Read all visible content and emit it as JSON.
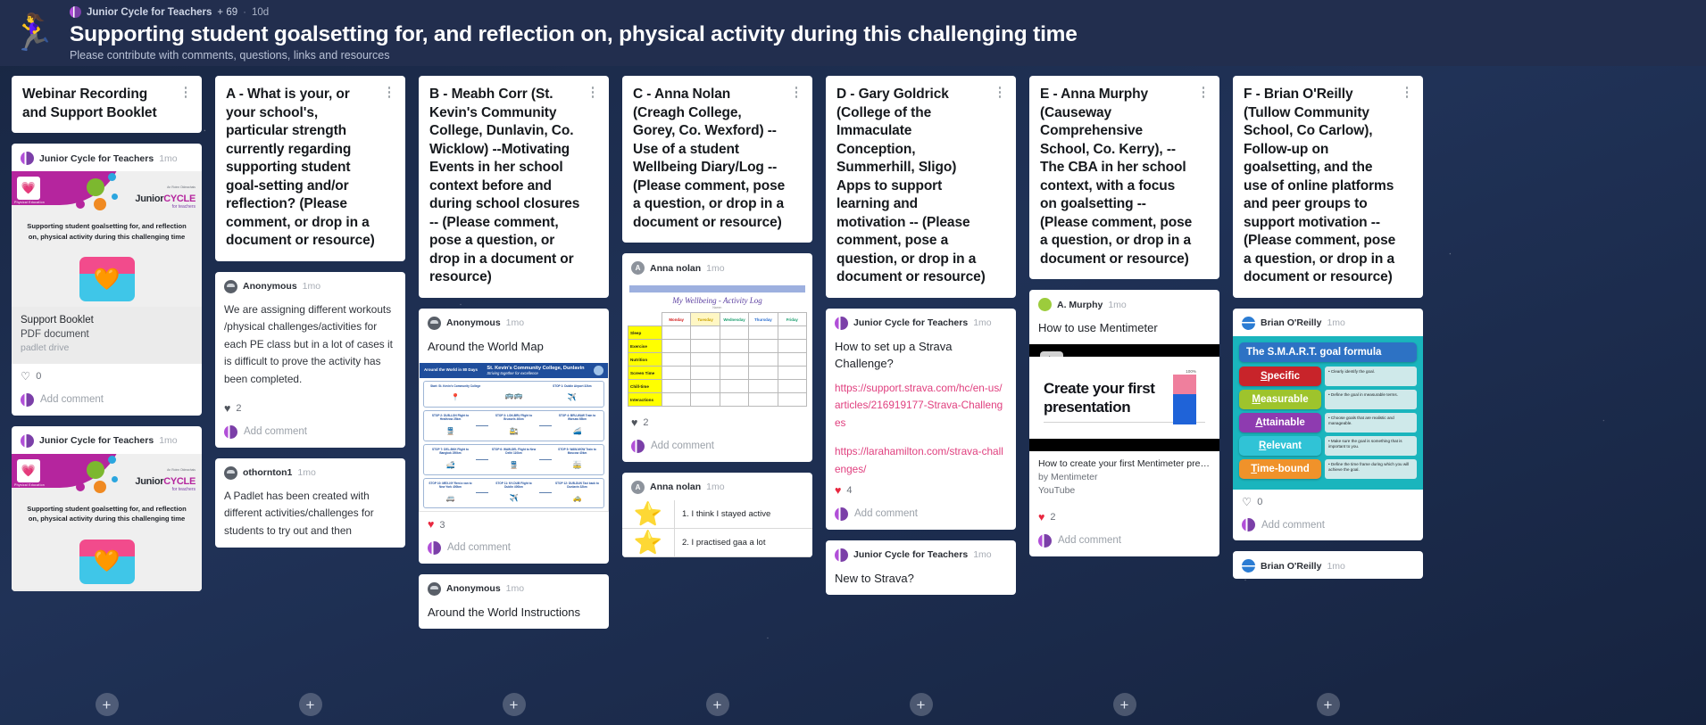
{
  "header": {
    "avatar_icon": "runner-emoji",
    "owner": "Junior Cycle for Teachers",
    "collaborators": "+ 69",
    "separator": "·",
    "updated": "10d",
    "title": "Supporting student goalsetting for, and reflection on, physical activity during this challenging time",
    "subtitle": "Please contribute with comments, questions, links and resources"
  },
  "ui": {
    "add_comment": "Add comment",
    "add_post": "+",
    "menu_icon": "kebab-menu-icon",
    "heart_icon": "heart-icon",
    "play_icon": "play-icon"
  },
  "columns": [
    {
      "title": "Webinar Recording and Support Booklet",
      "cards": [
        {
          "author": "Junior Cycle for Teachers",
          "avatar": "padlet",
          "ago": "1mo",
          "media": "jct-flyer",
          "flyer_caption": "Supporting student goalsetting for, and reflection on, physical activity during this challenging time",
          "flyer_brand_top": "An Roinn Oideachais",
          "flyer_brand": "JuniorCYCLE",
          "flyer_brand_sub": "for teachers",
          "flyer_badge": "Physical Education",
          "attachment_name": "Support Booklet",
          "attachment_kind": "PDF document",
          "attachment_source": "padlet drive",
          "likes": "0",
          "like_style": "empty"
        },
        {
          "author": "Junior Cycle for Teachers",
          "avatar": "padlet",
          "ago": "1mo",
          "media": "jct-flyer",
          "flyer_caption": "Supporting student goalsetting for, and reflection on, physical activity during this challenging time",
          "flyer_brand_top": "An Roinn Oideachais",
          "flyer_brand": "JuniorCYCLE",
          "flyer_brand_sub": "for teachers",
          "flyer_badge": "Physical Education"
        }
      ]
    },
    {
      "title": "A - What is your, or your school's, particular strength currently regarding supporting student goal-setting and/or reflection? (Please comment, or drop in a document or resource)",
      "cards": [
        {
          "author": "Anonymous",
          "avatar": "anon",
          "ago": "1mo",
          "text": "We are assigning different workouts /physical challenges/activities for each PE class but in a lot of cases it is difficult to prove the activity has been completed.",
          "likes": "2",
          "like_style": "dark"
        },
        {
          "author": "othornton1",
          "avatar": "anon",
          "ago": "1mo",
          "text": "A Padlet has been created with different activities/challenges for students to try out and then"
        }
      ]
    },
    {
      "title": "B - Meabh Corr (St. Kevin's Community College, Dunlavin, Co. Wicklow) --Motivating Events in her school context before and during school closures -- (Please comment, pose a question, or drop in a document or resource)",
      "cards": [
        {
          "author": "Anonymous",
          "avatar": "anon",
          "ago": "1mo",
          "title": "Around the World Map",
          "media": "world-map",
          "map_title": "St. Kevin's Community College, Dunlavin",
          "map_tagline": "Striving together for excellence",
          "map_label": "Around the World in 80 Days",
          "likes": "3",
          "like_style": "red"
        },
        {
          "author": "Anonymous",
          "avatar": "anon",
          "ago": "1mo",
          "title": "Around the World Instructions"
        }
      ]
    },
    {
      "title": "C - Anna Nolan (Creagh College, Gorey, Co. Wexford) -- Use of a student Wellbeing Diary/Log -- (Please comment, pose a question, or drop in a document or resource)",
      "cards": [
        {
          "author": "Anna nolan",
          "avatar": "letter",
          "avatar_letter": "A",
          "ago": "1mo",
          "media": "wellbeing-log",
          "log_title": "My Wellbeing - Activity Log",
          "log_sub": "Name:",
          "log_days": [
            "Monday",
            "Tuesday",
            "Wednesday",
            "Thursday",
            "Friday"
          ],
          "log_rows": [
            "Sleep",
            "Exercise",
            "Nutrition",
            "Screen Time",
            "Chill-time",
            "Interactions"
          ],
          "likes": "2",
          "like_style": "dark"
        },
        {
          "author": "Anna nolan",
          "avatar": "letter",
          "avatar_letter": "A",
          "ago": "1mo",
          "media": "star-list",
          "star_items": [
            "1. I think I stayed active",
            "2. I practised gaa a lot"
          ]
        }
      ]
    },
    {
      "title": "D - Gary Goldrick (College of the Immaculate Conception, Summerhill, Sligo) Apps to support learning and motivation -- (Please comment, pose a question, or drop in a document or resource)",
      "cards": [
        {
          "author": "Junior Cycle for Teachers",
          "avatar": "padlet",
          "ago": "1mo",
          "title": "How to set up a Strava Challenge?",
          "links": [
            "https://support.strava.com/hc/en-us/articles/216919177-Strava-Challenges",
            "https://larahamilton.com/strava-challenges/"
          ],
          "likes": "4",
          "like_style": "red"
        },
        {
          "author": "Junior Cycle for Teachers",
          "avatar": "padlet",
          "ago": "1mo",
          "title": "New to Strava?"
        }
      ]
    },
    {
      "title": "E - Anna Murphy (Causeway Comprehensive School, Co. Kerry), -- The CBA in her school context, with a focus on goalsetting -- (Please comment, pose a question, or drop in a document or resource)",
      "cards": [
        {
          "author": "A. Murphy",
          "avatar": "green",
          "ago": "1mo",
          "title": "How to use Mentimeter",
          "media": "video",
          "video_overlay": "Create your first presentation",
          "video_pct": "100%",
          "video_name": "How to create your first Mentimeter pres...",
          "video_by": "by Mentimeter",
          "video_source": "YouTube",
          "likes": "2",
          "like_style": "red"
        }
      ]
    },
    {
      "title": "F - Brian O'Reilly (Tullow Community School, Co Carlow), Follow-up on goalsetting, and the use of online platforms and peer groups to support motivation -- (Please comment, pose a question, or drop in a document or resource)",
      "cards": [
        {
          "author": "Brian O'Reilly",
          "avatar": "globe",
          "ago": "1mo",
          "media": "smart-goal",
          "smart_header": "The S.M.A.R.T. goal formula",
          "smart_rows": [
            {
              "label": "Specific",
              "initial": "S",
              "rest": "pecific",
              "desc": "Clearly identify the goal.",
              "color": "#c8242a"
            },
            {
              "label": "Measurable",
              "initial": "M",
              "rest": "easurable",
              "desc": "Define the goal in measurable terms.",
              "color": "#9ec42c"
            },
            {
              "label": "Attainable",
              "initial": "A",
              "rest": "ttainable",
              "desc": "Choose goals that are realistic and manageable.",
              "color": "#8e3bb0"
            },
            {
              "label": "Relevant",
              "initial": "R",
              "rest": "elevant",
              "desc": "Make sure the goal is something that is important to you.",
              "color": "#30c3d6"
            },
            {
              "label": "Time-bound",
              "initial": "T",
              "rest": "ime-bound",
              "desc": "Define the time frame during which you will achieve the goal.",
              "color": "#f0922a"
            }
          ],
          "likes": "0",
          "like_style": "empty"
        },
        {
          "author": "Brian O'Reilly",
          "avatar": "globe",
          "ago": "1mo"
        }
      ]
    }
  ]
}
